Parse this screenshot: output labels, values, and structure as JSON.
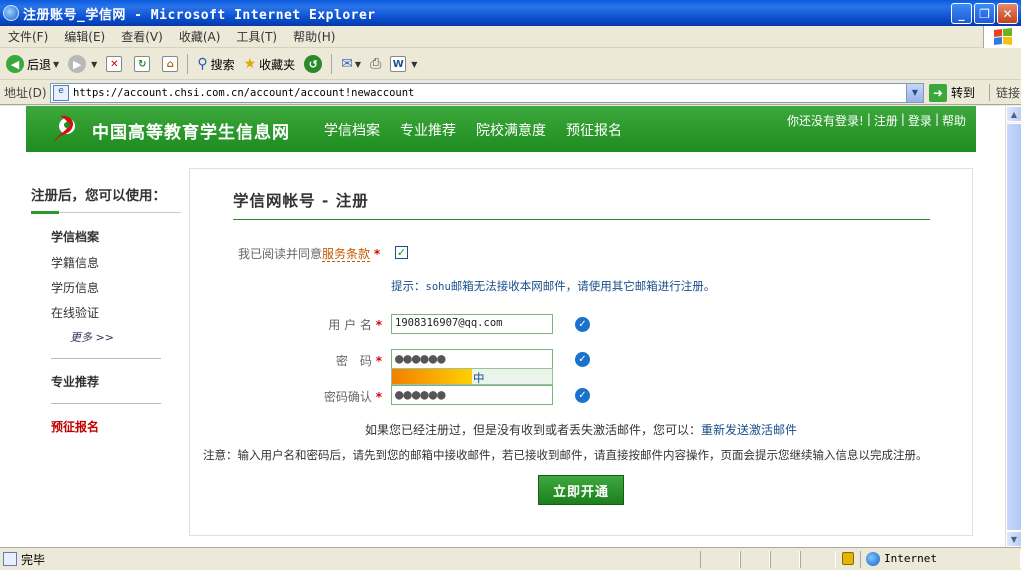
{
  "window": {
    "title": "注册账号_学信网 - Microsoft Internet Explorer",
    "buttons": {
      "minimize": "_",
      "maximize": "❐",
      "close": "✕"
    }
  },
  "menu": [
    "文件(F)",
    "编辑(E)",
    "查看(V)",
    "收藏(A)",
    "工具(T)",
    "帮助(H)"
  ],
  "toolbar": {
    "back": "后退",
    "search": "搜索",
    "favorites": "收藏夹"
  },
  "address": {
    "label": "地址(D)",
    "url": "https://account.chsi.com.cn/account/account!newaccount",
    "go": "转到",
    "links": "链接"
  },
  "site": {
    "name": "中国高等教育学生信息网",
    "nav": [
      "学信档案",
      "专业推荐",
      "院校满意度",
      "预征报名"
    ],
    "toplinks": {
      "status": "你还没有登录!",
      "register": "注册",
      "login": "登录",
      "help": "帮助"
    }
  },
  "sidebar": {
    "title": "注册后，您可以使用：",
    "section1": "学信档案",
    "items": [
      "学籍信息",
      "学历信息",
      "在线验证"
    ],
    "more": "更多 >>",
    "section2": "专业推荐",
    "section3": "预征报名"
  },
  "form": {
    "title": "学信网帐号 - 注册",
    "agree_prefix": "我已阅读并同意",
    "agree_link": "服务条款",
    "agree_checked": true,
    "tip_prefix": "提示：",
    "tip_mono": "sohu",
    "tip_rest": "邮箱无法接收本网邮件，请使用其它邮箱进行注册。",
    "username_label": "用 户 名",
    "username_value": "1908316907@qq.com",
    "password_label": "密　码",
    "password_mask": "●●●●●●",
    "strength_label": "中",
    "strength_level": 0.5,
    "confirm_label": "密码确认",
    "confirm_mask": "●●●●●●",
    "required_mark": "*",
    "ok_mark": "✓",
    "resend_text": "如果您已经注册过，但是没有收到或者丢失激活邮件，您可以：",
    "resend_link": "重新发送激活邮件",
    "note": "注意：输入用户名和密码后，请先到您的邮箱中接收邮件，若已接收到邮件，请直接按邮件内容操作，页面会提示您继续输入信息以完成注册。",
    "submit": "立即开通"
  },
  "status": {
    "text": "完毕",
    "zone": "Internet"
  },
  "colors": {
    "brand_green": "#2A9A2A",
    "link_blue": "#1A4F8B",
    "required_red": "#E00000",
    "accent_orange": "#C05B00"
  }
}
